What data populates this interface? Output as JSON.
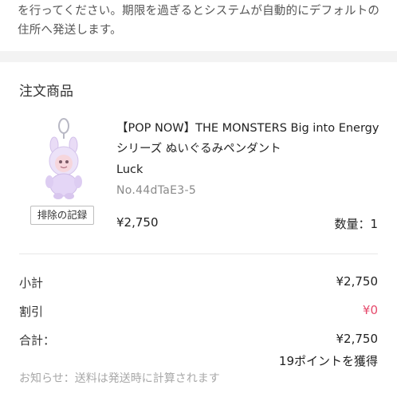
{
  "notice": {
    "line1": "を行ってください。期限を過ぎるとシステムが自動的にデフォルトの",
    "line2": "住所へ発送します。"
  },
  "order": {
    "section_title": "注文商品",
    "item": {
      "name": "【POP NOW】THE MONSTERS Big into Energy シリーズ ぬいぐるみペンダント",
      "variant": "Luck",
      "sku": "No.44dTaE3-5",
      "price": "¥2,750",
      "quantity": "数量：1",
      "remove_label": "排除の記録",
      "image_icon": "plush-keychain-image"
    }
  },
  "summary": {
    "subtotal_label": "小計",
    "subtotal_value": "¥2,750",
    "discount_label": "割引",
    "discount_value": "¥0",
    "total_label": "合計：",
    "total_value": "¥2,750",
    "points": "19ポイントを獲得",
    "footnote": "お知らせ：送料は発送時に計算されます"
  },
  "colors": {
    "accent_discount": "#e64a6c",
    "background_gap": "#f3f3f3"
  }
}
